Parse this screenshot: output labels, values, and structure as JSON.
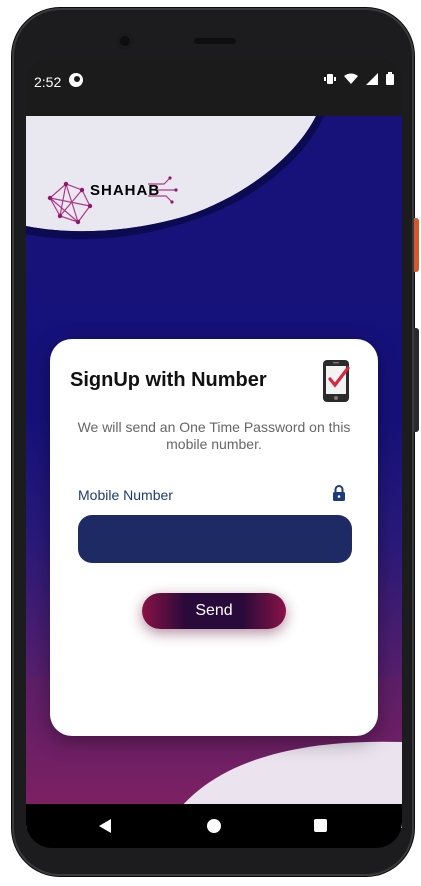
{
  "status_bar": {
    "time": "2:52"
  },
  "app": {
    "brand": "SHAHAB"
  },
  "card": {
    "title": "SignUp with Number",
    "description": "We will send an One Time Password on this mobile number.",
    "field_label": "Mobile Number",
    "field_value": "",
    "send_label": "Send"
  },
  "icons": {
    "status": [
      "g-icon",
      "vibrate-icon",
      "wifi-icon",
      "signal-icon",
      "battery-icon"
    ],
    "nav": [
      "back-icon",
      "home-icon",
      "recents-icon"
    ],
    "card": [
      "phone-check-icon",
      "lock-icon"
    ]
  },
  "colors": {
    "app_bg": "#15117a",
    "accent_field": "#1e2a64",
    "label_blue": "#1d3b7a",
    "button_magenta": "#8a1246"
  }
}
